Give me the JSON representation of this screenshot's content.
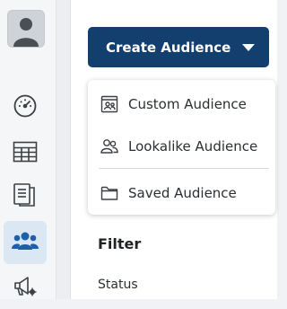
{
  "sidebar": {
    "avatar_icon": "user-avatar-icon",
    "items": [
      {
        "name": "dashboard",
        "icon": "speedometer-icon",
        "active": false
      },
      {
        "name": "table",
        "icon": "table-icon",
        "active": false
      },
      {
        "name": "reports",
        "icon": "documents-icon",
        "active": false
      },
      {
        "name": "audiences",
        "icon": "people-icon",
        "active": true
      },
      {
        "name": "campaigns",
        "icon": "megaphone-icon",
        "active": false
      }
    ]
  },
  "create_button": {
    "label": "Create Audience",
    "icon": "caret-down-icon"
  },
  "menu": {
    "items": [
      {
        "label": "Custom Audience",
        "icon": "custom-audience-icon"
      },
      {
        "label": "Lookalike Audience",
        "icon": "lookalike-people-icon"
      },
      {
        "label": "Saved Audience",
        "icon": "folder-icon"
      }
    ]
  },
  "filter": {
    "title": "Filter",
    "status_label": "Status"
  },
  "colors": {
    "primary_button": "#123f6e",
    "active_nav_bg": "#dbe7f3",
    "active_icon": "#1d5fa8",
    "icon_gray": "#3c4043"
  }
}
